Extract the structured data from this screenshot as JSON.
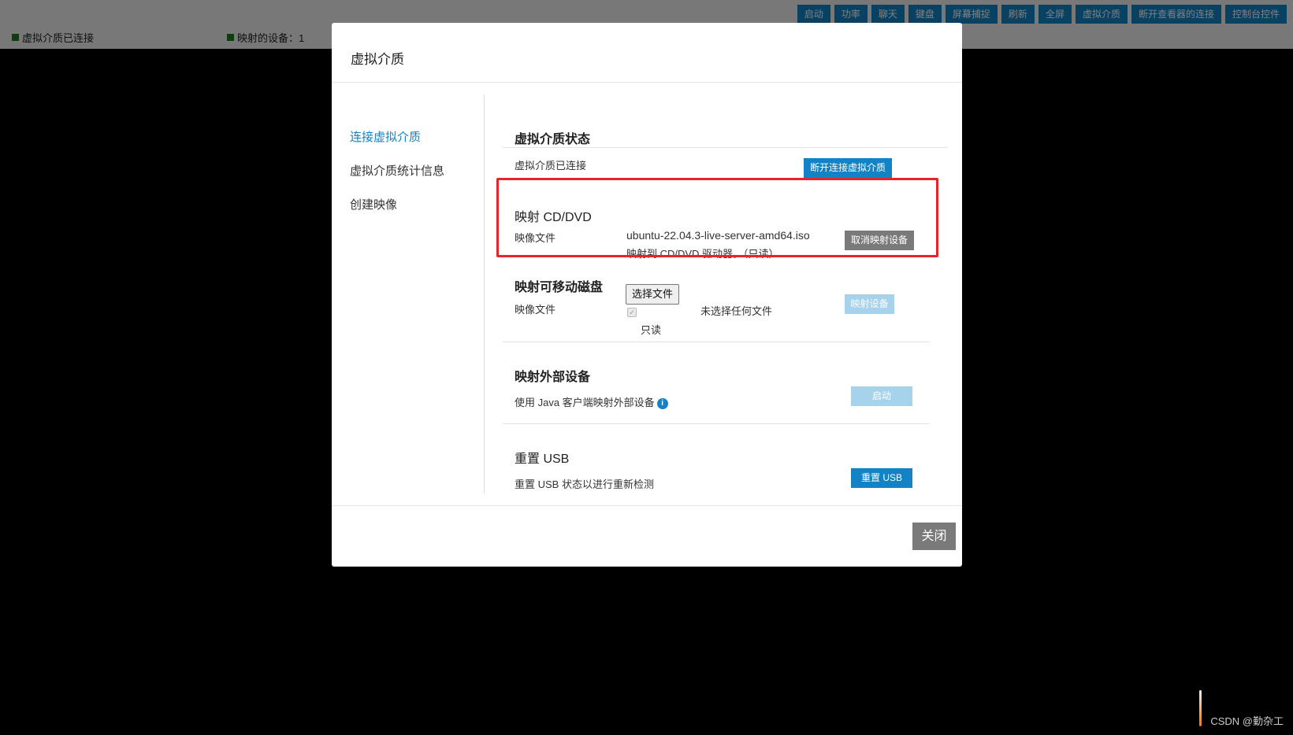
{
  "topbar": {
    "status_media": "虚拟介质已连接",
    "status_devices": "映射的设备：1",
    "buttons": [
      "启动",
      "功率",
      "聊天",
      "键盘",
      "屏幕捕捉",
      "刷新",
      "全屏",
      "虚拟介质",
      "断开查看器的连接",
      "控制台控件"
    ]
  },
  "dialog": {
    "title": "虚拟介质",
    "nav": [
      "连接虚拟介质",
      "虚拟介质统计信息",
      "创建映像"
    ],
    "status_section": {
      "title": "虚拟介质状态",
      "status_text": "虚拟介质已连接",
      "disconnect_button": "断开连接虚拟介质"
    },
    "cd_section": {
      "title": "映射 CD/DVD",
      "image_label": "映像文件",
      "image_file": "ubuntu-22.04.3-live-server-amd64.iso",
      "mapped_to": "映射到 CD/DVD 驱动器。（只读）",
      "unmap_button": "取消映射设备"
    },
    "removable_section": {
      "title": "映射可移动磁盘",
      "image_label": "映像文件",
      "choose_file_button": "选择文件",
      "no_file_text": "未选择任何文件",
      "readonly_label": "只读",
      "map_button": "映射设备"
    },
    "external_section": {
      "title": "映射外部设备",
      "description": "使用 Java 客户端映射外部设备",
      "start_button": "启动"
    },
    "usb_section": {
      "title": "重置 USB",
      "description": "重置 USB 状态以进行重新检测",
      "reset_button": "重置 USB"
    },
    "close_button": "关闭"
  },
  "watermark": "CSDN @勤杂工",
  "colors": {
    "accent": "#1383c6",
    "highlight": "#e8242a",
    "status_green": "#1d7a1d"
  }
}
